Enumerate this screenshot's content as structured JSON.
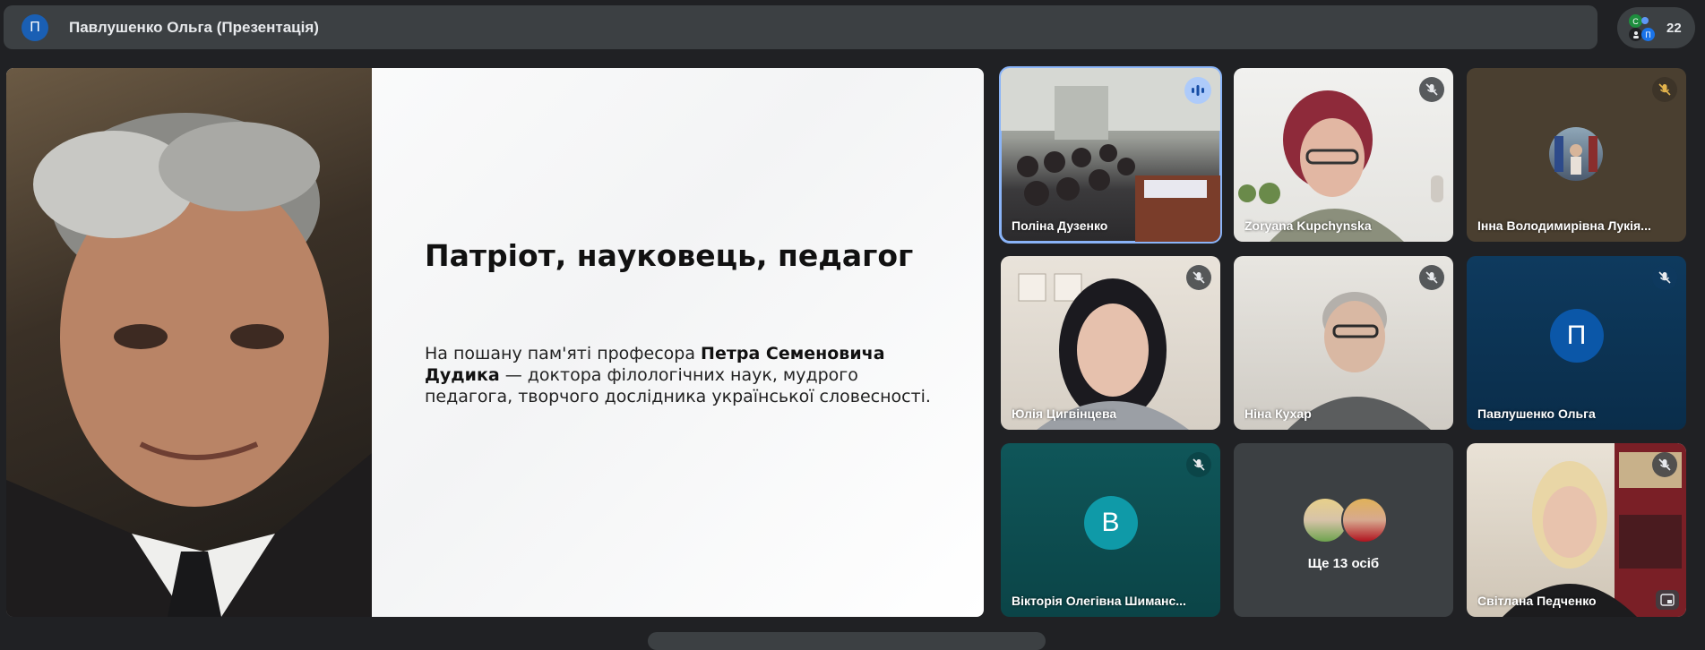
{
  "header": {
    "presenter_initial": "П",
    "title": "Павлушенко Ольга (Презентація)",
    "participants_count": "22",
    "mini_initials": [
      "С",
      "П"
    ]
  },
  "slide": {
    "title": "Патріот, науковець, педагог",
    "text_prefix": "На пошану пам'яті професора ",
    "text_bold": "Петра Семеновича Дудика",
    "text_suffix": " — доктора філологічних наук, мудрого педагога, творчого дослідника української словесності."
  },
  "tiles": [
    {
      "name": "Поліна Дузенко",
      "state": "speaking"
    },
    {
      "name": "Zoryana Kupchynska",
      "state": "muted"
    },
    {
      "name": "Інна Володимирівна Лукія...",
      "state": "muted"
    },
    {
      "name": "Юлія Цигвінцева",
      "state": "muted"
    },
    {
      "name": "Ніна Кухар",
      "state": "muted"
    },
    {
      "name": "Павлушенко Ольга",
      "state": "muted",
      "initial": "П",
      "avatar_color": "#0b57a8"
    },
    {
      "name": "Вікторія Олегівна Шиманс...",
      "state": "muted",
      "initial": "В",
      "avatar_color": "#0f9aa8"
    },
    {
      "more_label": "Ще 13 осіб"
    },
    {
      "name": "Світлана Педченко",
      "state": "muted"
    }
  ],
  "colors": {
    "active_outline": "#8ab4f8",
    "background": "#202124",
    "bar": "#3c4043"
  }
}
